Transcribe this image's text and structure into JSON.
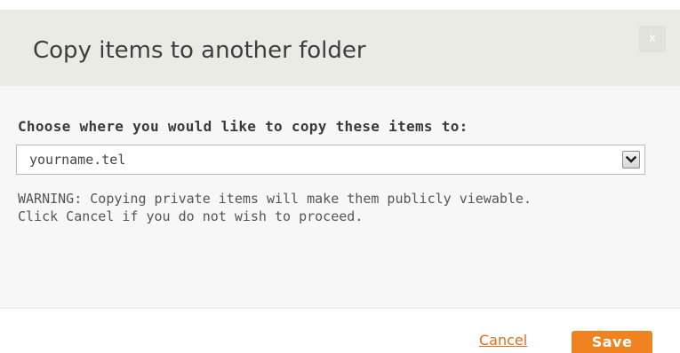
{
  "dialog": {
    "title": "Copy items to another folder",
    "close_label": "x",
    "prompt": "Choose where you would like to copy these items to:",
    "folder_select": {
      "selected_value": "yourname.tel"
    },
    "warning_lines": [
      "WARNING: Copying private items will make them publicly viewable.",
      "Click Cancel if you do not wish to proceed."
    ],
    "cancel_label": "Cancel",
    "save_label": "Save"
  },
  "colors": {
    "accent": "#f0821f",
    "link": "#e06f1f",
    "header_bg": "#ebebe5",
    "body_bg": "#f7f7f7"
  },
  "icons": {
    "close": "close-icon",
    "dropdown": "chevron-down-icon"
  }
}
